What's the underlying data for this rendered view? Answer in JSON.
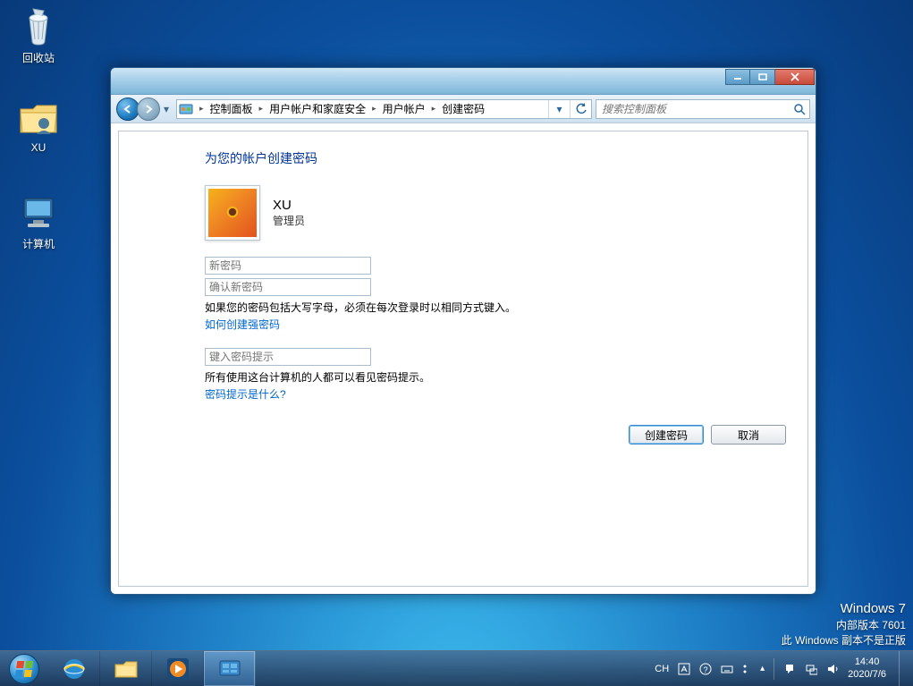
{
  "desktop": {
    "recycle_bin": "回收站",
    "user_folder": "XU",
    "computer": "计算机"
  },
  "window": {
    "breadcrumb": [
      "控制面板",
      "用户帐户和家庭安全",
      "用户帐户",
      "创建密码"
    ],
    "search_placeholder": "搜索控制面板",
    "heading": "为您的帐户创建密码",
    "user": {
      "name": "XU",
      "role": "管理员"
    },
    "fields": {
      "new_password_placeholder": "新密码",
      "confirm_password_placeholder": "确认新密码",
      "hint1": "如果您的密码包括大写字母，必须在每次登录时以相同方式键入。",
      "link1": "如何创建强密码",
      "hint_input_placeholder": "键入密码提示",
      "hint2": "所有使用这台计算机的人都可以看见密码提示。",
      "link2": "密码提示是什么?"
    },
    "buttons": {
      "create": "创建密码",
      "cancel": "取消"
    }
  },
  "watermark": {
    "line1": "Windows 7",
    "line2": "内部版本 7601",
    "line3": "此 Windows 副本不是正版"
  },
  "taskbar": {
    "ime": "CH",
    "time": "14:40",
    "date": "2020/7/6"
  }
}
